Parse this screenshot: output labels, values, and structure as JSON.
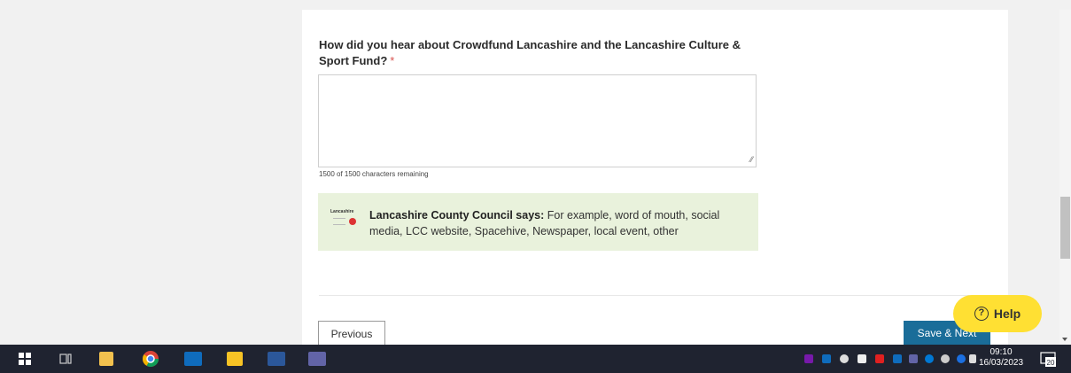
{
  "form": {
    "question": "How did you hear about Crowdfund Lancashire and the Lancashire Culture & Sport Fund?",
    "required_marker": "*",
    "answer_value": "",
    "counter": "1500 of 1500 characters remaining"
  },
  "council_note": {
    "logo_text": "Lancashire",
    "speaker": "Lancashire County Council says:",
    "text": "For example, word of mouth, social media, LCC website, Spacehive, Newspaper, local event, other"
  },
  "nav": {
    "previous_label": "Previous",
    "next_label": "Save & Next"
  },
  "help": {
    "label": "Help",
    "icon_glyph": "?"
  },
  "taskbar": {
    "time": "09:10",
    "date": "16/03/2023",
    "notification_count": "20",
    "apps": [
      "windows-start-icon",
      "task-view-icon",
      "file-explorer-icon",
      "chrome-icon",
      "outlook-icon",
      "sticky-notes-icon",
      "word-icon",
      "teams-icon"
    ]
  }
}
